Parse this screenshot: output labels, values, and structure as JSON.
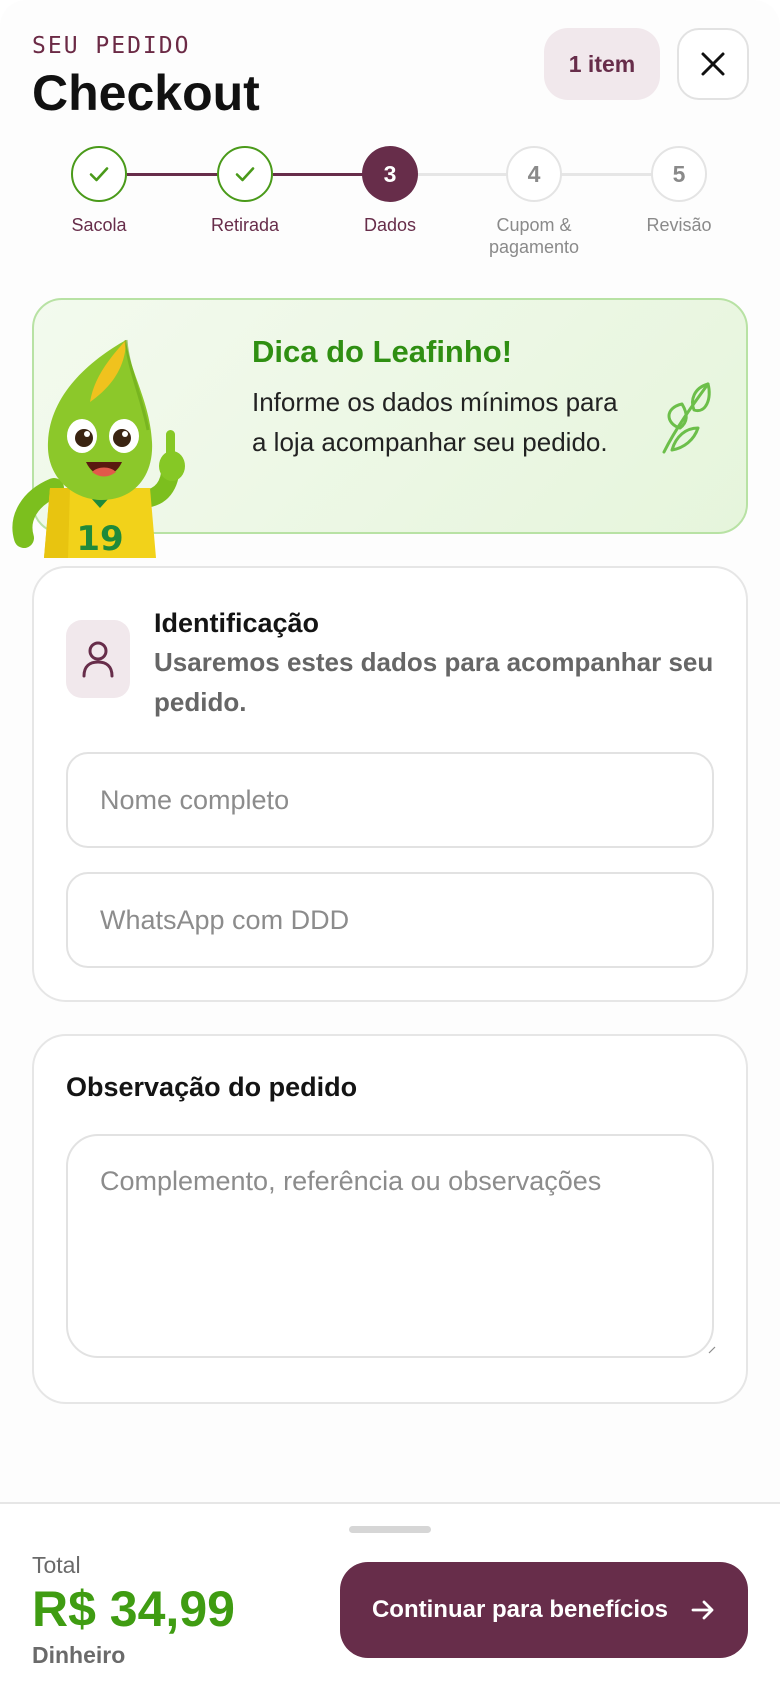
{
  "header": {
    "eyebrow": "SEU PEDIDO",
    "title": "Checkout",
    "item_count": "1 item"
  },
  "stepper": {
    "current_step": 3,
    "steps": [
      {
        "number": "1",
        "label": "Sacola",
        "state": "done"
      },
      {
        "number": "2",
        "label": "Retirada",
        "state": "done"
      },
      {
        "number": "3",
        "label": "Dados",
        "state": "active"
      },
      {
        "number": "4",
        "label": "Cupom &",
        "label_line2": "pagamento",
        "state": "todo"
      },
      {
        "number": "5",
        "label": "Revisão",
        "state": "todo"
      }
    ]
  },
  "tip": {
    "title": "Dica do Leafinho!",
    "text": "Informe os dados mínimos para a loja acompanhar seu pedido.",
    "mascot_jersey_number": "19"
  },
  "identification": {
    "title": "Identificação",
    "subtitle": "Usaremos estes dados para acompanhar seu pedido.",
    "name_placeholder": "Nome completo",
    "name_value": "",
    "phone_placeholder": "WhatsApp com DDD",
    "phone_value": ""
  },
  "observation": {
    "title": "Observação do pedido",
    "placeholder": "Complemento, referência ou observações",
    "value": ""
  },
  "footer": {
    "total_label": "Total",
    "total_value": "R$ 34,99",
    "payment_method": "Dinheiro",
    "cta_label": "Continuar para benefícios"
  },
  "colors": {
    "brand": "#672d4a",
    "accent_green": "#3f9c12",
    "tip_background": "#e9f6e0",
    "step_done_ring": "#4a9a1a"
  },
  "icons": {
    "close": "close-icon",
    "check": "check-icon",
    "leaf": "leaf-icon",
    "user": "user-icon",
    "arrow": "arrow-right-icon"
  }
}
